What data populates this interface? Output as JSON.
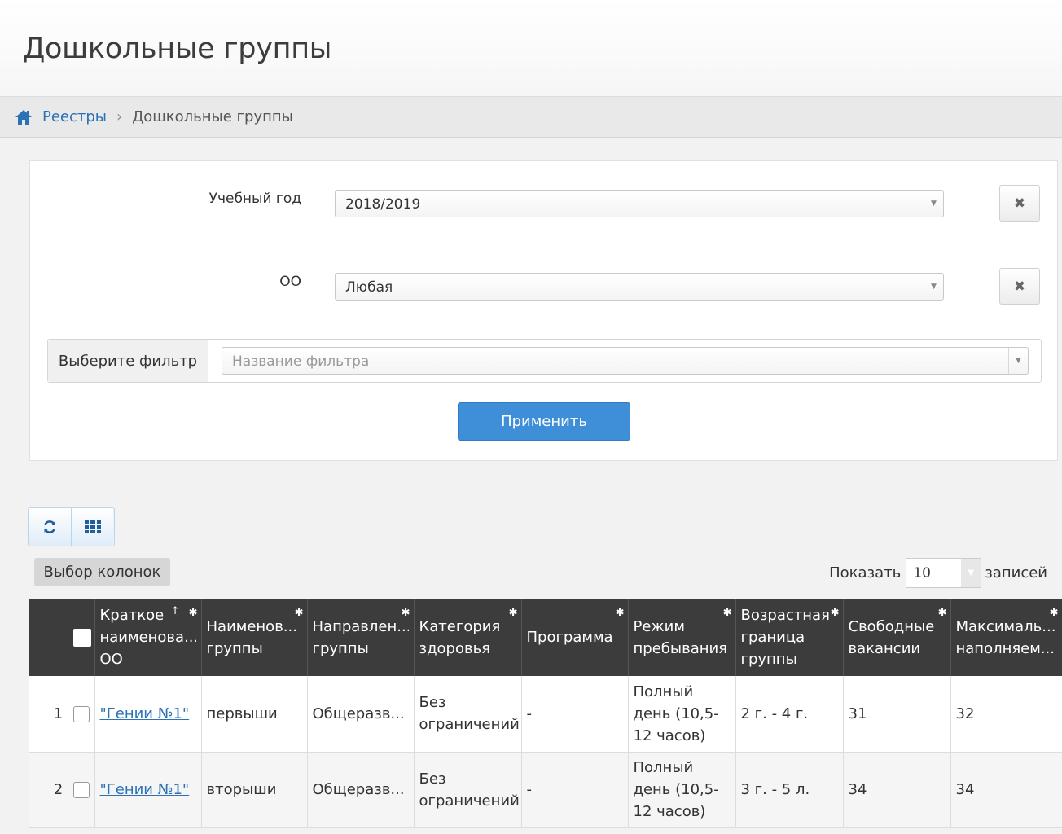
{
  "page": {
    "title": "Дошкольные группы"
  },
  "breadcrumb": {
    "home_icon": "home-icon",
    "parent": "Реестры",
    "separator": "›",
    "current": "Дошкольные группы"
  },
  "filters": {
    "year": {
      "label": "Учебный год",
      "value": "2018/2019",
      "clear": "✖"
    },
    "oo": {
      "label": "ОО",
      "value": "Любая",
      "clear": "✖"
    },
    "named": {
      "label": "Выберите фильтр",
      "placeholder": "Название фильтра"
    },
    "apply_label": "Применить"
  },
  "toolbar": {
    "refresh_icon": "refresh-icon",
    "grid_icon": "grid-icon"
  },
  "columns_button": "Выбор колонок",
  "page_size": {
    "prefix": "Показать",
    "value": "10",
    "suffix": "записей"
  },
  "table": {
    "headers": {
      "short_name": "Краткое наименова... ОО",
      "group_name": "Наименов... группы",
      "direction": "Направлен... группы",
      "health": "Категория здоровья",
      "program": "Программа",
      "mode": "Режим пребывания",
      "age": "Возрастная граница группы",
      "vacancies": "Свободные вакансии",
      "capacity": "Максималь... наполняем..."
    },
    "sort_indicator": "↑",
    "rows": [
      {
        "num": "1",
        "oo": "\"Гении №1\"",
        "group": "первыши",
        "direction": "Общеразв...",
        "health": "Без ограничений",
        "program": "-",
        "mode": "Полный день (10,5-12 часов)",
        "age": "2 г. - 4 г.",
        "vacancies": "31",
        "capacity": "32"
      },
      {
        "num": "2",
        "oo": "\"Гении №1\"",
        "group": "вторыши",
        "direction": "Общеразв...",
        "health": "Без ограничений",
        "program": "-",
        "mode": "Полный день (10,5-12 часов)",
        "age": "3 г. - 5 л.",
        "vacancies": "34",
        "capacity": "34"
      }
    ]
  },
  "colors": {
    "primary": "#3e8ed8",
    "link": "#2a72b5",
    "header_bg": "#3c3c3c"
  }
}
